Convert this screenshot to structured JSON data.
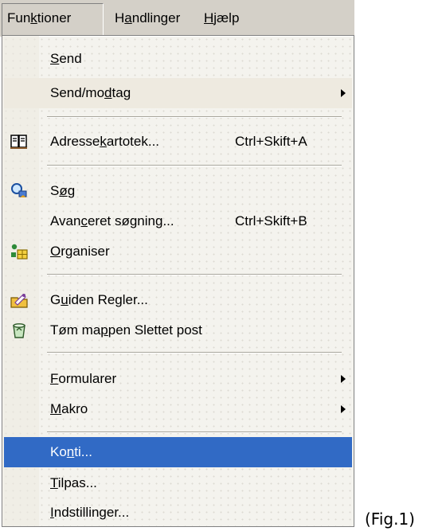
{
  "menubar": {
    "items": [
      {
        "pre": "Fun",
        "ul": "k",
        "post": "tioner"
      },
      {
        "pre": "H",
        "ul": "a",
        "post": "ndlinger"
      },
      {
        "pre": "",
        "ul": "H",
        "post": "jælp"
      }
    ]
  },
  "menu": {
    "send": {
      "pre": "",
      "ul": "S",
      "post": "end"
    },
    "send_receive": {
      "pre": "Send/mo",
      "ul": "d",
      "post": "tag"
    },
    "address_book": {
      "pre": "Adresse",
      "ul": "k",
      "post": "artotek...",
      "shortcut": "Ctrl+Skift+A",
      "icon": "address-book-icon"
    },
    "find": {
      "pre": "S",
      "ul": "ø",
      "post": "g",
      "icon": "find-icon"
    },
    "advanced_find": {
      "pre": "Avan",
      "ul": "c",
      "post": "eret søgning...",
      "shortcut": "Ctrl+Skift+B"
    },
    "organize": {
      "pre": "",
      "ul": "O",
      "post": "rganiser",
      "icon": "organize-icon"
    },
    "rules_wizard": {
      "pre": "G",
      "ul": "u",
      "post": "iden Regler...",
      "icon": "rules-wizard-icon"
    },
    "empty_deleted": {
      "pre": "Tøm ma",
      "ul": "p",
      "post": "pen Slettet post",
      "icon": "recycle-bin-icon"
    },
    "forms": {
      "pre": "",
      "ul": "F",
      "post": "ormularer"
    },
    "macro": {
      "pre": "",
      "ul": "M",
      "post": "akro"
    },
    "accounts": {
      "pre": "Ko",
      "ul": "n",
      "post": "ti..."
    },
    "customize": {
      "pre": "",
      "ul": "T",
      "post": "ilpas..."
    },
    "options": {
      "pre": "",
      "ul": "I",
      "post": "ndstillinger..."
    }
  },
  "figure_label": "(Fig.1)",
  "colors": {
    "highlight": "#316ac5",
    "menu_bg": "#f4f3ee",
    "bar_bg": "#d4d0c8"
  }
}
